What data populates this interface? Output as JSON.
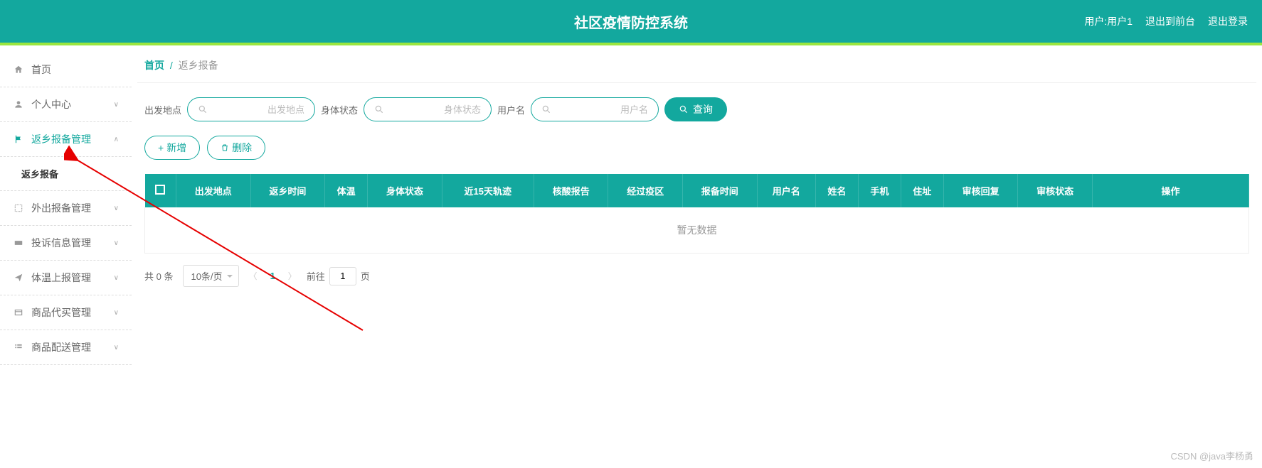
{
  "header": {
    "title": "社区疫情防控系统",
    "user_label": "用户:用户1",
    "to_front": "退出到前台",
    "logout": "退出登录"
  },
  "sidebar": {
    "items": [
      {
        "label": "首页",
        "icon": "home"
      },
      {
        "label": "个人中心",
        "icon": "user",
        "arrow": "down"
      },
      {
        "label": "返乡报备管理",
        "icon": "flag",
        "arrow": "up",
        "active": true,
        "sub": "返乡报备"
      },
      {
        "label": "外出报备管理",
        "icon": "expand",
        "arrow": "down"
      },
      {
        "label": "投诉信息管理",
        "icon": "ticket",
        "arrow": "down"
      },
      {
        "label": "体温上报管理",
        "icon": "send",
        "arrow": "down"
      },
      {
        "label": "商品代买管理",
        "icon": "cart",
        "arrow": "down"
      },
      {
        "label": "商品配送管理",
        "icon": "list",
        "arrow": "down"
      }
    ]
  },
  "breadcrumb": {
    "home": "首页",
    "current": "返乡报备"
  },
  "search": {
    "f1_label": "出发地点",
    "f1_ph": "出发地点",
    "f2_label": "身体状态",
    "f2_ph": "身体状态",
    "f3_label": "用户名",
    "f3_ph": "用户名",
    "btn": "查询"
  },
  "actions": {
    "add": "新增",
    "del": "删除"
  },
  "table": {
    "cols": [
      "出发地点",
      "返乡时间",
      "体温",
      "身体状态",
      "近15天轨迹",
      "核酸报告",
      "经过疫区",
      "报备时间",
      "用户名",
      "姓名",
      "手机",
      "住址",
      "审核回复",
      "审核状态",
      "操作"
    ],
    "empty": "暂无数据"
  },
  "pagination": {
    "total": "共 0 条",
    "size": "10条/页",
    "current": "1",
    "goto_prefix": "前往",
    "goto_val": "1",
    "goto_suffix": "页"
  },
  "watermark": "CSDN @java李杨勇"
}
